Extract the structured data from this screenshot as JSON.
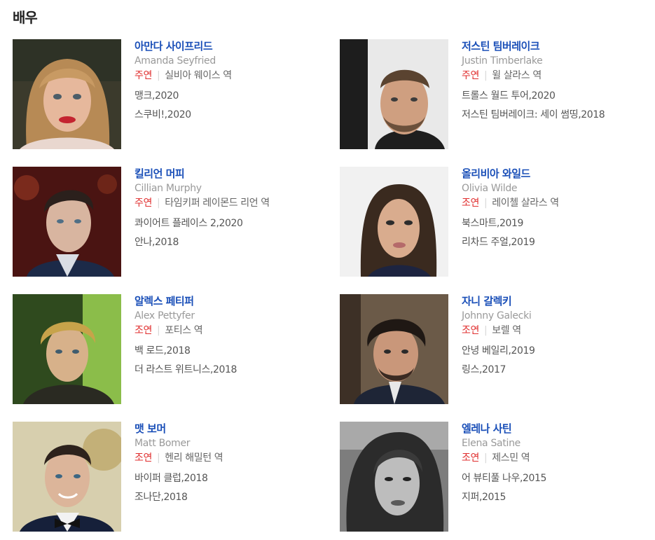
{
  "section": {
    "title": "배우"
  },
  "actors": [
    {
      "name_ko": "아만다 사이프리드",
      "name_en": "Amanda Seyfried",
      "role_type": "주연",
      "role": "실비아 웨이스 역",
      "works": [
        "맹크,2020",
        "스쿠비!,2020"
      ]
    },
    {
      "name_ko": "저스틴 팀버레이크",
      "name_en": "Justin Timberlake",
      "role_type": "주연",
      "role": "윌 살라스 역",
      "works": [
        "트롤스 월드 투어,2020",
        "저스틴 팀버레이크: 세이 썸띵,2018"
      ]
    },
    {
      "name_ko": "킬리언 머피",
      "name_en": "Cillian Murphy",
      "role_type": "주연",
      "role": "타임키퍼 레이몬드 리언 역",
      "works": [
        "콰이어트 플레이스 2,2020",
        "안나,2018"
      ]
    },
    {
      "name_ko": "올리비아 와일드",
      "name_en": "Olivia Wilde",
      "role_type": "조연",
      "role": "레이첼 살라스 역",
      "works": [
        "북스마트,2019",
        "리차드 주얼,2019"
      ]
    },
    {
      "name_ko": "알렉스 페티퍼",
      "name_en": "Alex Pettyfer",
      "role_type": "조연",
      "role": "포티스 역",
      "works": [
        "백 로드,2018",
        "더 라스트 위트니스,2018"
      ]
    },
    {
      "name_ko": "자니 갈렉키",
      "name_en": "Johnny Galecki",
      "role_type": "조연",
      "role": "보렐 역",
      "works": [
        "안녕 베일리,2019",
        "링스,2017"
      ]
    },
    {
      "name_ko": "맷 보머",
      "name_en": "Matt Bomer",
      "role_type": "조연",
      "role": "헨리 해밀턴 역",
      "works": [
        "바이퍼 클럽,2018",
        "조나단,2018"
      ]
    },
    {
      "name_ko": "엘레나 사틴",
      "name_en": "Elena Satine",
      "role_type": "조연",
      "role": "제스민 역",
      "works": [
        "어 뷰티풀 나우,2015",
        "지퍼,2015"
      ]
    }
  ],
  "colors": {
    "name_link": "#1a4fb8",
    "role_type": "#e02e2e",
    "muted": "#999999"
  }
}
